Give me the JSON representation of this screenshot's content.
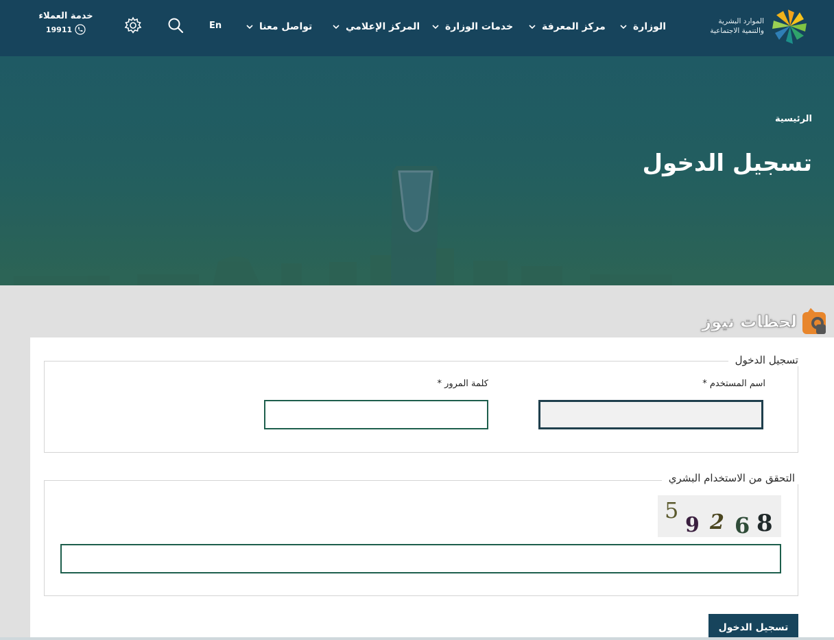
{
  "header": {
    "logo_line1": "الموارد البشرية",
    "logo_line2": "والتنمية الاجتماعية",
    "nav": [
      {
        "label": "الوزارة"
      },
      {
        "label": "مركز المعرفة"
      },
      {
        "label": "خدمات الوزارة"
      },
      {
        "label": "المركز الإعلامي"
      },
      {
        "label": "تواصل معنا"
      }
    ],
    "language": "En",
    "customer_service_label": "خدمة العملاء",
    "customer_service_number": "19911"
  },
  "hero": {
    "breadcrumb": "الرئيسية",
    "title": "تسجيل الدخول"
  },
  "watermark": {
    "text": "لحظات نيوز"
  },
  "login": {
    "legend": "تسجيل الدخول",
    "username_label": "اسم المستخدم *",
    "username_value": "",
    "password_label": "كلمة المرور *",
    "password_value": ""
  },
  "captcha": {
    "legend": "التحقق من الاستخدام البشري",
    "digits": [
      "5",
      "9",
      "2",
      "6",
      "8"
    ],
    "digit_colors": [
      "#5b5a2e",
      "#3a1f3f",
      "#4b4620",
      "#2f4c38",
      "#20292a"
    ],
    "input_value": ""
  },
  "actions": {
    "submit_label": "تسجيل الدخول"
  },
  "colors": {
    "header_bg": "#17445c",
    "hero_bg": "#225e60",
    "input_border": "#1d5e4c",
    "button_bg": "#17445c"
  }
}
